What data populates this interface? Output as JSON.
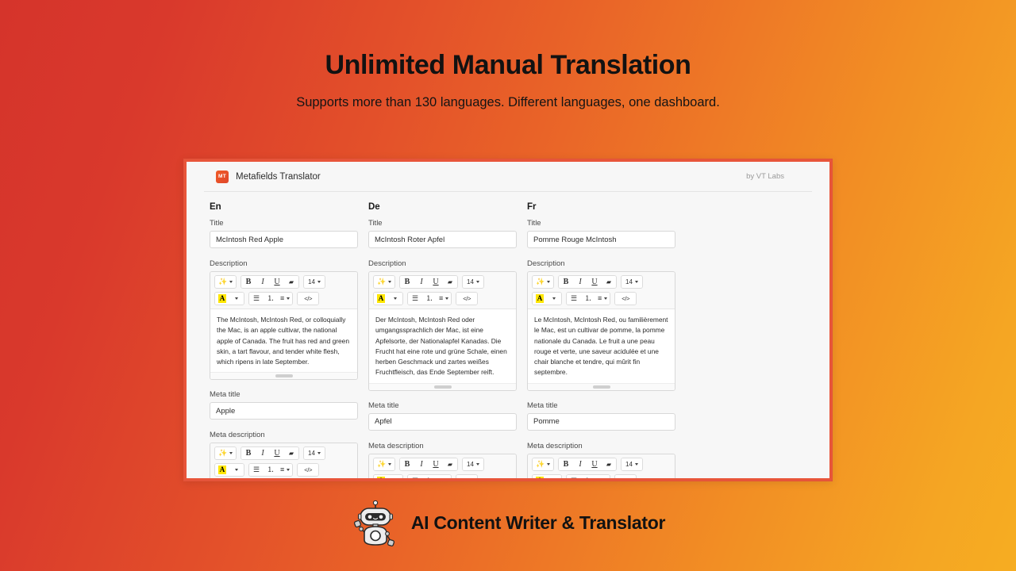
{
  "hero": {
    "title": "Unlimited Manual Translation",
    "subtitle": "Supports more than 130 languages. Different languages, one dashboard."
  },
  "app": {
    "logo_text": "MT",
    "name": "Metafields Translator",
    "by": "by VT Labs"
  },
  "labels": {
    "title": "Title",
    "description": "Description",
    "meta_title": "Meta title",
    "meta_description": "Meta description"
  },
  "toolbar": {
    "wand": "✨",
    "bold": "B",
    "italic": "I",
    "underline": "U",
    "clear_format": "█",
    "font_size": "14",
    "highlight": "A",
    "bullet_list": "☰",
    "numbered_list": "☲",
    "align": "≡",
    "code": "</>",
    "icons": {
      "wand": "magic-wand-icon",
      "bold": "bold-icon",
      "italic": "italic-icon",
      "underline": "underline-icon",
      "eraser": "clear-formatting-icon",
      "size_caret": "chevron-down-icon",
      "highlight": "text-color-icon",
      "bullets": "bullet-list-icon",
      "numbers": "numbered-list-icon",
      "align": "align-icon",
      "code": "code-view-icon"
    }
  },
  "columns": [
    {
      "code": "En",
      "title": "McIntosh Red Apple",
      "description": "The McIntosh, McIntosh Red, or colloquially the Mac, is an apple cultivar, the national apple of Canada. The fruit has red and green skin, a tart flavour, and tender white flesh, which ripens in late September.",
      "meta_title": "Apple"
    },
    {
      "code": "De",
      "title": "McIntosh Roter Apfel",
      "description": "Der McIntosh, McIntosh Red oder umgangssprachlich der Mac, ist eine Apfelsorte, der Nationalapfel Kanadas. Die Frucht hat eine rote und grüne Schale, einen herben Geschmack und zartes weißes Fruchtfleisch, das Ende September reift.",
      "meta_title": "Apfel"
    },
    {
      "code": "Fr",
      "title": "Pomme Rouge McIntosh",
      "description": "Le McIntosh, McIntosh Red, ou familièrement le Mac, est un cultivar de pomme, la pomme nationale du Canada. Le fruit a une peau rouge et verte, une saveur acidulée et une chair blanche et tendre, qui mûrit fin septembre.",
      "meta_title": "Pomme"
    }
  ],
  "brand": {
    "text": "AI Content Writer & Translator",
    "icon": "robot-icon"
  },
  "colors": {
    "gradient_start": "#d5342b",
    "gradient_end": "#f6ad22",
    "card_border": "#e8553a",
    "highlight_yellow": "#ffe600",
    "logo_orange": "#f05b28"
  }
}
